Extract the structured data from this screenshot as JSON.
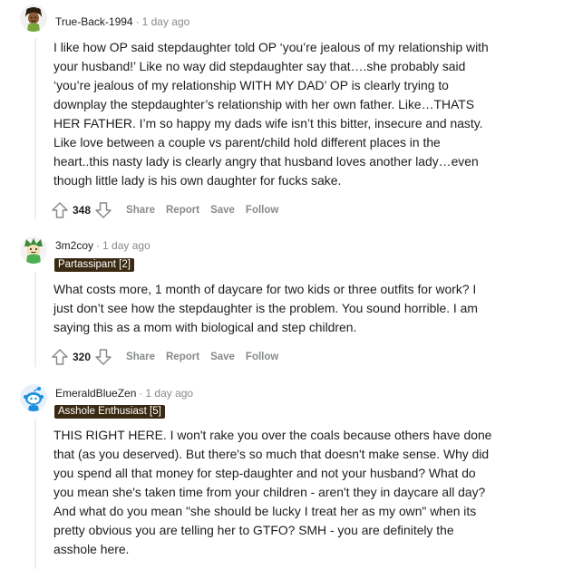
{
  "comments": [
    {
      "username": "True-Back-1994",
      "time": "1 day ago",
      "flair": "",
      "body": [
        "I like how OP said stepdaughter told OP ‘you’re jealous of my relationship with",
        "your husband!’ Like no way did stepdaughter say that….she probably said",
        "‘you’re jealous of my relationship WITH MY DAD’ OP is clearly trying to",
        "downplay the stepdaughter’s relationship with her own father. Like…THATS",
        "HER FATHER. I’m so happy my dads wife isn’t this bitter, insecure and nasty.",
        "Like love between a couple vs parent/child hold different places in the",
        "heart..this nasty lady is clearly angry that husband loves another lady…even",
        "though little lady is his own daughter for fucks sake."
      ],
      "score": "348"
    },
    {
      "username": "3m2coy",
      "time": "1 day ago",
      "flair": "Partassipant [2]",
      "body": [
        "What costs more, 1 month of daycare for two kids or three outfits for work? I",
        "just don’t see how the stepdaughter is the problem. You sound horrible. I am",
        "saying this as a mom with biological and step children."
      ],
      "score": "320"
    },
    {
      "username": "EmeraldBlueZen",
      "time": "1 day ago",
      "flair": "Asshole Enthusiast [5]",
      "body": [
        "THIS RIGHT HERE. I won't rake you over the coals because others have done",
        "that (as you deserved). But there's so much that doesn't make sense. Why did",
        "you spend all that money for step-daughter and not your husband? What do",
        "you mean she's taken time from your children - aren't they in daycare all day?",
        "And what do you mean \"she should be lucky I treat her as my own\" when its",
        "pretty obvious you are telling her to GTFO? SMH - you are definitely the",
        "asshole here."
      ]
    }
  ],
  "actions": {
    "share": "Share",
    "report": "Report",
    "save": "Save",
    "follow": "Follow"
  },
  "separator": "·",
  "colors": {
    "flair_bg": "#3b2a12",
    "meta_gray": "#878a8c",
    "thread_line": "#edeff1"
  }
}
